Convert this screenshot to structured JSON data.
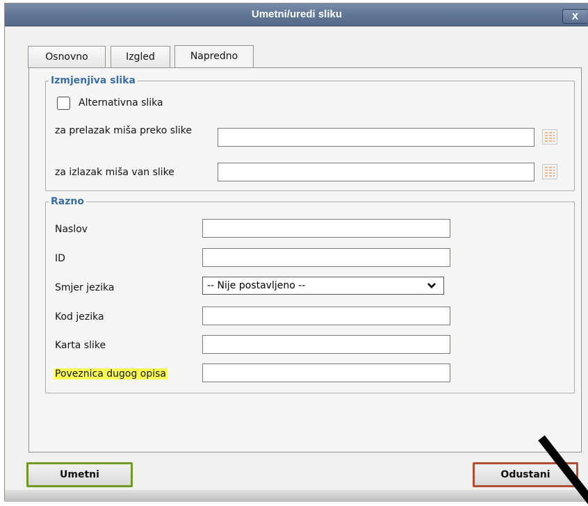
{
  "dialog": {
    "title": "Umetni/uredi sliku",
    "close_label": "x"
  },
  "tabs": [
    {
      "label": "Osnovno",
      "active": false
    },
    {
      "label": "Izgled",
      "active": false
    },
    {
      "label": "Napredno",
      "active": true
    }
  ],
  "swap_image": {
    "legend": "Izmjenjiva slika",
    "alt_image_label": "Alternativna slika",
    "alt_image_checked": false,
    "mouse_over_label": "za prelazak miša preko slike",
    "mouse_over_value": "",
    "mouse_out_label": "za izlazak miša van slike",
    "mouse_out_value": ""
  },
  "misc": {
    "legend": "Razno",
    "title_label": "Naslov",
    "title_value": "",
    "id_label": "ID",
    "id_value": "",
    "dir_label": "Smjer jezika",
    "dir_selected": "-- Nije postavljeno --",
    "lang_code_label": "Kod jezika",
    "lang_code_value": "",
    "image_map_label": "Karta slike",
    "image_map_value": "",
    "long_desc_label": "Poveznica dugog opisa",
    "long_desc_value": ""
  },
  "buttons": {
    "insert": "Umetni",
    "cancel": "Odustani"
  },
  "colors": {
    "titlebar": "#5f7594",
    "legend_text": "#3a6ea5",
    "highlight": "#fbff4f",
    "insert_border": "#6e9a23",
    "cancel_border": "#b24e33"
  }
}
